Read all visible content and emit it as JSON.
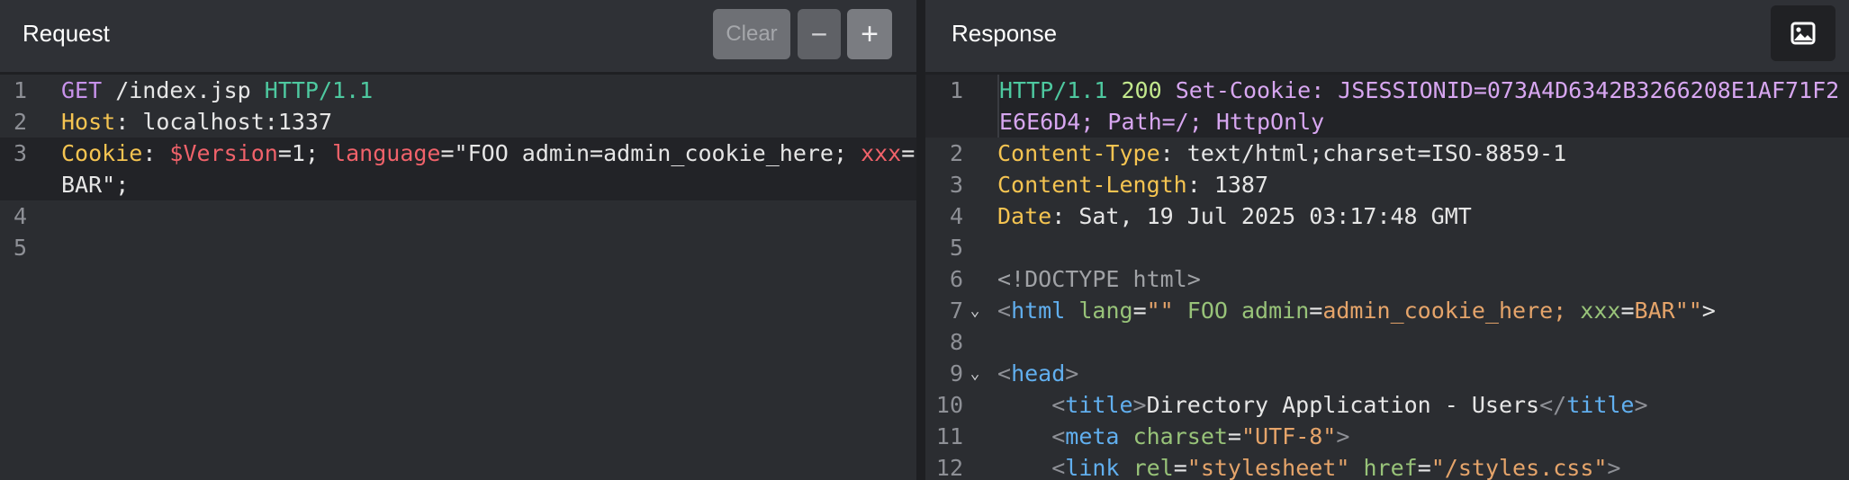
{
  "request": {
    "title": "Request",
    "buttons": {
      "clear": "Clear",
      "minus": "−",
      "plus": "+"
    },
    "lines": [
      {
        "num": "1",
        "tokens": [
          [
            "GET",
            "c-method"
          ],
          [
            " /index.jsp ",
            "c-val"
          ],
          [
            "HTTP/1.1",
            "c-proto"
          ]
        ]
      },
      {
        "num": "2",
        "tokens": [
          [
            "Host",
            "c-hkey"
          ],
          [
            ": localhost:1337",
            "c-val"
          ]
        ]
      },
      {
        "num": "3",
        "active": true,
        "tokens": [
          [
            "Cookie",
            "c-hkey"
          ],
          [
            ": ",
            "c-val"
          ],
          [
            "$Version",
            "c-red"
          ],
          [
            "=1; ",
            "c-val"
          ],
          [
            "language",
            "c-red"
          ],
          [
            "=\"FOO admin=admin_cookie_here; ",
            "c-val"
          ],
          [
            "xxx",
            "c-red"
          ],
          [
            "=BAR\";",
            "c-val"
          ]
        ]
      },
      {
        "num": "4",
        "tokens": []
      },
      {
        "num": "5",
        "tokens": []
      }
    ]
  },
  "response": {
    "title": "Response",
    "image_button_icon": "image-icon",
    "lines": [
      {
        "num": "1",
        "active": true,
        "tokens": [
          [
            "HTTP/1.1",
            "c-proto"
          ],
          [
            " ",
            "c-val"
          ],
          [
            "200",
            "c-status"
          ],
          [
            " Set-Cookie: JSESSIONID=073A4D6342B3266208E1AF71F2E6E6D4; Path=/; HttpOnly",
            "c-cookie"
          ]
        ]
      },
      {
        "num": "2",
        "tokens": [
          [
            "Content-Type",
            "c-hkey"
          ],
          [
            ": text/html;charset=ISO-8859-1",
            "c-val"
          ]
        ]
      },
      {
        "num": "3",
        "tokens": [
          [
            "Content-Length",
            "c-hkey"
          ],
          [
            ": 1387",
            "c-val"
          ]
        ]
      },
      {
        "num": "4",
        "tokens": [
          [
            "Date",
            "c-hkey"
          ],
          [
            ": Sat, 19 Jul 2025 03:17:48 GMT",
            "c-val"
          ]
        ]
      },
      {
        "num": "5",
        "tokens": []
      },
      {
        "num": "6",
        "tokens": [
          [
            "<!DOCTYPE html>",
            "c-muted"
          ]
        ]
      },
      {
        "num": "7",
        "fold": "⌄",
        "tokens": [
          [
            "<",
            "c-tagb"
          ],
          [
            "html",
            "c-tag"
          ],
          [
            " ",
            "c-val"
          ],
          [
            "lang",
            "c-attr"
          ],
          [
            "=",
            "c-val"
          ],
          [
            "\"\"",
            "c-str"
          ],
          [
            " FOO admin",
            "c-attr"
          ],
          [
            "=",
            "c-val"
          ],
          [
            "admin_cookie_here;",
            "c-str"
          ],
          [
            " xxx",
            "c-attr"
          ],
          [
            "=",
            "c-val"
          ],
          [
            "BAR",
            "c-str"
          ],
          [
            "\"\"",
            "c-str"
          ],
          [
            ">",
            "c-val"
          ]
        ]
      },
      {
        "num": "8",
        "tokens": []
      },
      {
        "num": "9",
        "fold": "⌄",
        "tokens": [
          [
            "<",
            "c-tagb"
          ],
          [
            "head",
            "c-tag"
          ],
          [
            ">",
            "c-tagb"
          ]
        ]
      },
      {
        "num": "10",
        "tokens": [
          [
            "    <",
            "c-tagb"
          ],
          [
            "title",
            "c-tag"
          ],
          [
            ">",
            "c-tagb"
          ],
          [
            "Directory Application - Users",
            "c-val"
          ],
          [
            "</",
            "c-tagb"
          ],
          [
            "title",
            "c-tag"
          ],
          [
            ">",
            "c-tagb"
          ]
        ]
      },
      {
        "num": "11",
        "tokens": [
          [
            "    <",
            "c-tagb"
          ],
          [
            "meta",
            "c-tag"
          ],
          [
            " ",
            "c-val"
          ],
          [
            "charset",
            "c-attr"
          ],
          [
            "=",
            "c-val"
          ],
          [
            "\"UTF-8\"",
            "c-str"
          ],
          [
            ">",
            "c-tagb"
          ]
        ]
      },
      {
        "num": "12",
        "tokens": [
          [
            "    <",
            "c-tagb"
          ],
          [
            "link",
            "c-tag"
          ],
          [
            " ",
            "c-val"
          ],
          [
            "rel",
            "c-attr"
          ],
          [
            "=",
            "c-val"
          ],
          [
            "\"stylesheet\"",
            "c-str"
          ],
          [
            " ",
            "c-val"
          ],
          [
            "href",
            "c-attr"
          ],
          [
            "=",
            "c-val"
          ],
          [
            "\"/styles.css\"",
            "c-str"
          ],
          [
            ">",
            "c-tagb"
          ]
        ]
      }
    ]
  }
}
